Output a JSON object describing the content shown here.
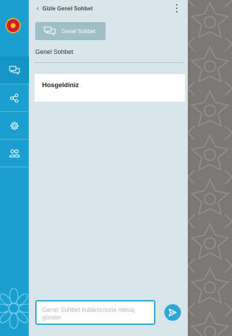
{
  "header": {
    "back_label": "Gizle Genel Sohbet"
  },
  "chat": {
    "button_label": "Genel Sohbet",
    "section_title": "Genel Sohbet"
  },
  "messages": [
    {
      "text": "Hosgeldiniz"
    }
  ],
  "composer": {
    "placeholder": "Genel Sohbet kullanıcısına mesaj gönder"
  },
  "rail": {
    "items": [
      {
        "icon": "chat-bubbles-icon",
        "active": true
      },
      {
        "icon": "share-icon",
        "active": false
      },
      {
        "icon": "gear-icon",
        "active": false
      },
      {
        "icon": "users-icon",
        "active": false
      }
    ]
  },
  "colors": {
    "rail": "#1a9fd0",
    "panel": "#d6e6ea",
    "accent": "#2fa7d4",
    "pattern": "#7a7874"
  }
}
